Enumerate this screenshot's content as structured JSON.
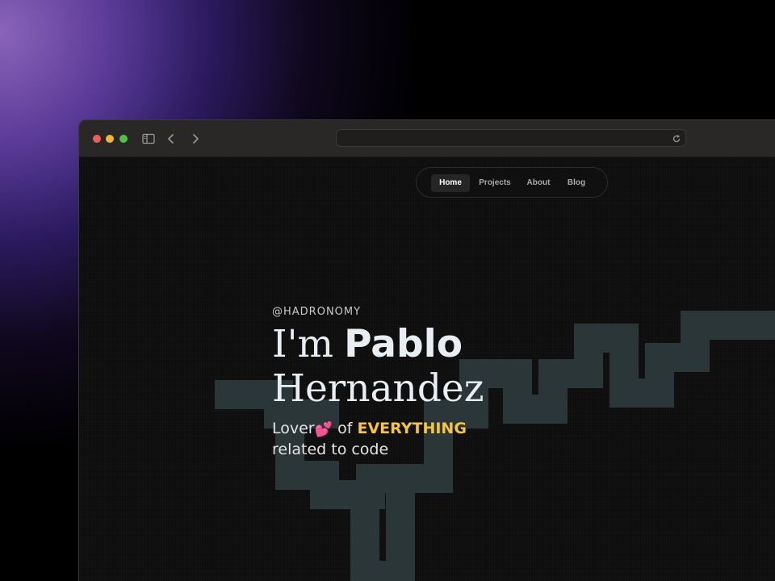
{
  "nav": {
    "items": [
      {
        "label": "Home",
        "active": true
      },
      {
        "label": "Projects",
        "active": false
      },
      {
        "label": "About",
        "active": false
      },
      {
        "label": "Blog",
        "active": false
      }
    ]
  },
  "hero": {
    "handle": "@HADRONOMY",
    "greeting": "I'm",
    "first_name": "Pablo",
    "last_name": "Hernandez",
    "tagline_prefix": "Lover",
    "heart_icon": "💕",
    "tagline_connector": "of",
    "tagline_highlight": "EVERYTHING",
    "tagline_suffix": "related to code"
  },
  "colors": {
    "accent": "#f5c542",
    "heart": "#ff3d7a",
    "shape": "#2a3638",
    "traffic_red": "#ee5e56",
    "traffic_yellow": "#f2b533",
    "traffic_green": "#4fc245"
  }
}
